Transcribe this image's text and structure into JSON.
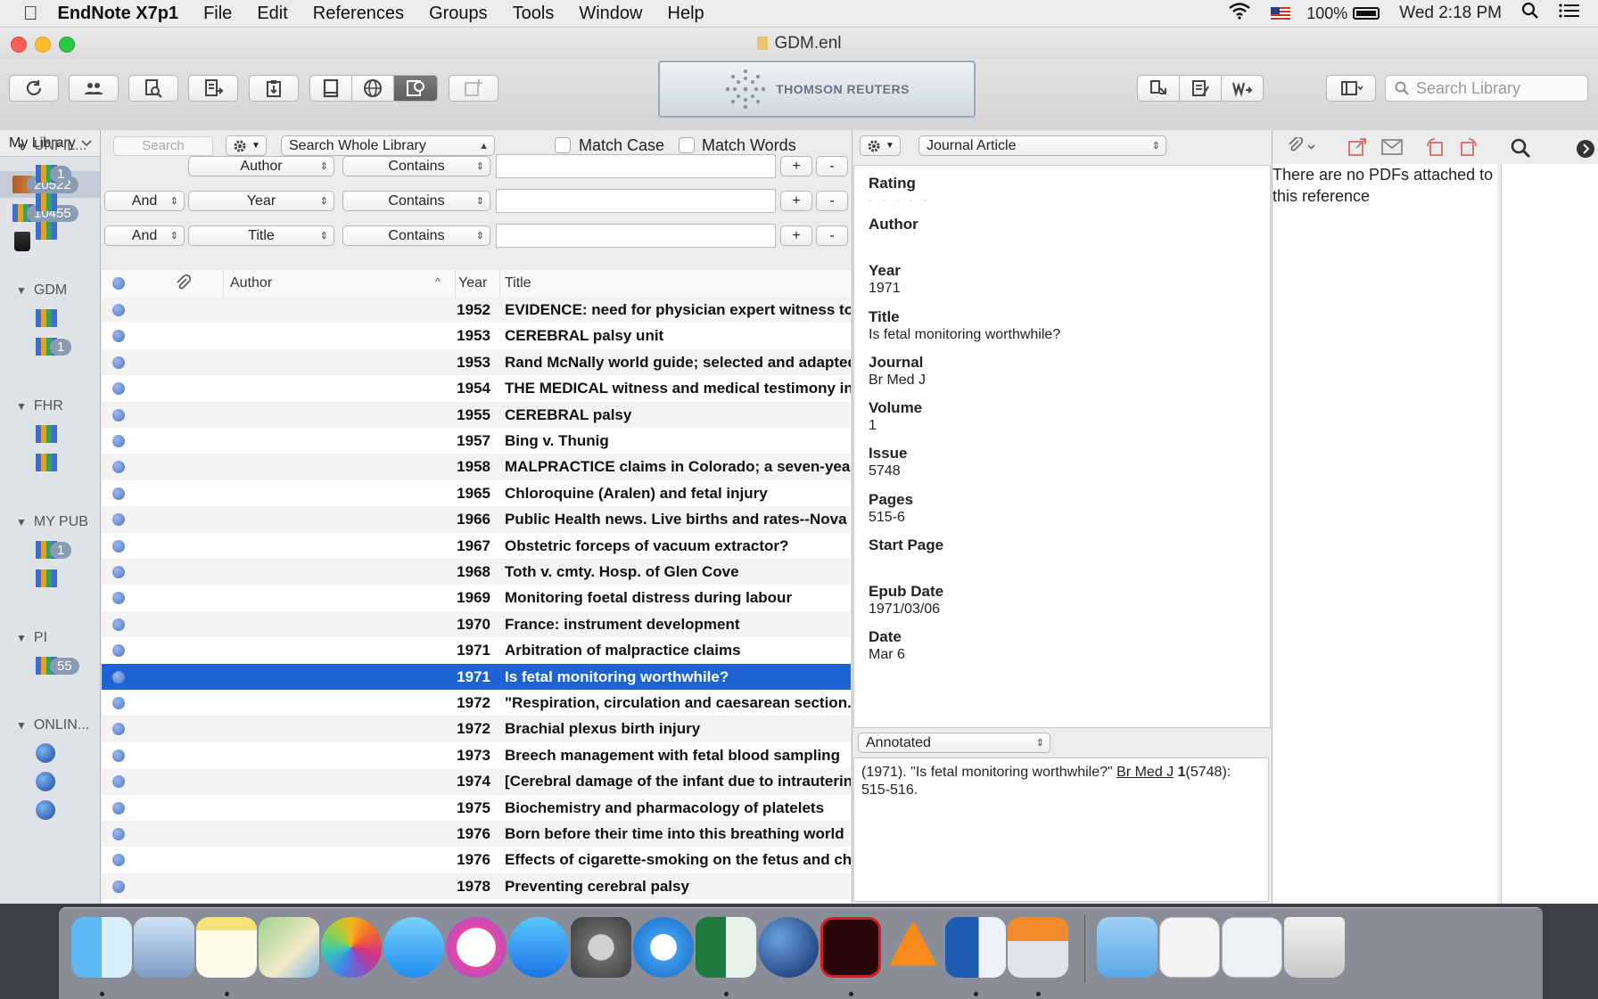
{
  "menubar": {
    "app_name": "EndNote X7p1",
    "items": [
      "File",
      "Edit",
      "References",
      "Groups",
      "Tools",
      "Window",
      "Help"
    ],
    "battery": "100%",
    "clock": "Wed 2:18 PM"
  },
  "window": {
    "title": "GDM.enl",
    "banner": "THOMSON REUTERS",
    "search_library_placeholder": "Search Library"
  },
  "groups": {
    "header": "My Library",
    "all_refs": "20522",
    "unfiled": "10455",
    "sections": [
      {
        "name": "UNFIL...",
        "badges": [
          "1",
          "",
          ""
        ]
      },
      {
        "name": "GDM",
        "badges": [
          "",
          "1"
        ]
      },
      {
        "name": "FHR",
        "badges": [
          "",
          ""
        ]
      },
      {
        "name": "MY PUB",
        "badges": [
          "1",
          ""
        ]
      },
      {
        "name": "PI",
        "badges": [
          "55"
        ]
      },
      {
        "name": "ONLIN...",
        "badges": [
          "",
          "",
          ""
        ]
      }
    ]
  },
  "search": {
    "quick_search_placeholder": "Search",
    "scope": "Search Whole Library",
    "match_case": "Match Case",
    "match_words": "Match Words",
    "rows": [
      {
        "bool": "",
        "field": "Author",
        "op": "Contains",
        "value": ""
      },
      {
        "bool": "And",
        "field": "Year",
        "op": "Contains",
        "value": ""
      },
      {
        "bool": "And",
        "field": "Title",
        "op": "Contains",
        "value": ""
      }
    ],
    "plus": "+",
    "minus": "-"
  },
  "reflist": {
    "columns": {
      "author": "Author",
      "year": "Year",
      "title": "Title"
    },
    "rows": [
      {
        "year": "1952",
        "title": "EVIDENCE: need for physician expert witness to"
      },
      {
        "year": "1953",
        "title": "CEREBRAL palsy unit"
      },
      {
        "year": "1953",
        "title": "Rand McNally world guide; selected and adapted"
      },
      {
        "year": "1954",
        "title": "THE MEDICAL witness and medical testimony in"
      },
      {
        "year": "1955",
        "title": "CEREBRAL palsy"
      },
      {
        "year": "1957",
        "title": "Bing v. Thunig"
      },
      {
        "year": "1958",
        "title": "MALPRACTICE claims in Colorado; a seven-year"
      },
      {
        "year": "1965",
        "title": "Chloroquine (Aralen) and fetal injury"
      },
      {
        "year": "1966",
        "title": "Public Health news. Live births and rates--Nova S"
      },
      {
        "year": "1967",
        "title": "Obstetric forceps of vacuum extractor?"
      },
      {
        "year": "1968",
        "title": "Toth v. cmty. Hosp. of Glen Cove"
      },
      {
        "year": "1969",
        "title": "Monitoring foetal distress during labour"
      },
      {
        "year": "1970",
        "title": "France: instrument development"
      },
      {
        "year": "1971",
        "title": "Arbitration of malpractice claims"
      },
      {
        "year": "1971",
        "title": "Is fetal monitoring worthwhile?",
        "selected": true
      },
      {
        "year": "1972",
        "title": "\"Respiration, circulation and caesarean section.\""
      },
      {
        "year": "1972",
        "title": "Brachial plexus birth injury"
      },
      {
        "year": "1973",
        "title": "Breech management with fetal blood sampling"
      },
      {
        "year": "1974",
        "title": "[Cerebral damage of the infant due to intrauterine"
      },
      {
        "year": "1975",
        "title": "Biochemistry and pharmacology of platelets"
      },
      {
        "year": "1976",
        "title": "Born before their time into this breathing world"
      },
      {
        "year": "1976",
        "title": "Effects of cigarette-smoking on the fetus and chi"
      },
      {
        "year": "1978",
        "title": "Preventing cerebral palsy"
      }
    ]
  },
  "reference": {
    "type": "Journal Article",
    "fields": [
      {
        "label": "Rating",
        "value": "· · · · ·"
      },
      {
        "label": "Author",
        "value": ""
      },
      {
        "label": "Year",
        "value": "1971"
      },
      {
        "label": "Title",
        "value": "Is fetal monitoring worthwhile?"
      },
      {
        "label": "Journal",
        "value": "Br Med J"
      },
      {
        "label": "Volume",
        "value": "1"
      },
      {
        "label": "Issue",
        "value": "5748"
      },
      {
        "label": "Pages",
        "value": "515-6"
      },
      {
        "label": "Start Page",
        "value": ""
      },
      {
        "label": "Epub Date",
        "value": "1971/03/06"
      },
      {
        "label": "Date",
        "value": "Mar 6"
      }
    ],
    "style": "Annotated",
    "preview": {
      "part1": "(1971). \"Is fetal monitoring worthwhile?\" ",
      "journal": "Br Med J",
      "volume": "1",
      "rest": "(5748): 515-516."
    }
  },
  "pdf": {
    "message": "There are no PDFs attached to this reference"
  },
  "colors": {
    "selection": "#1e63d2",
    "badge": "#8a9bb4"
  }
}
